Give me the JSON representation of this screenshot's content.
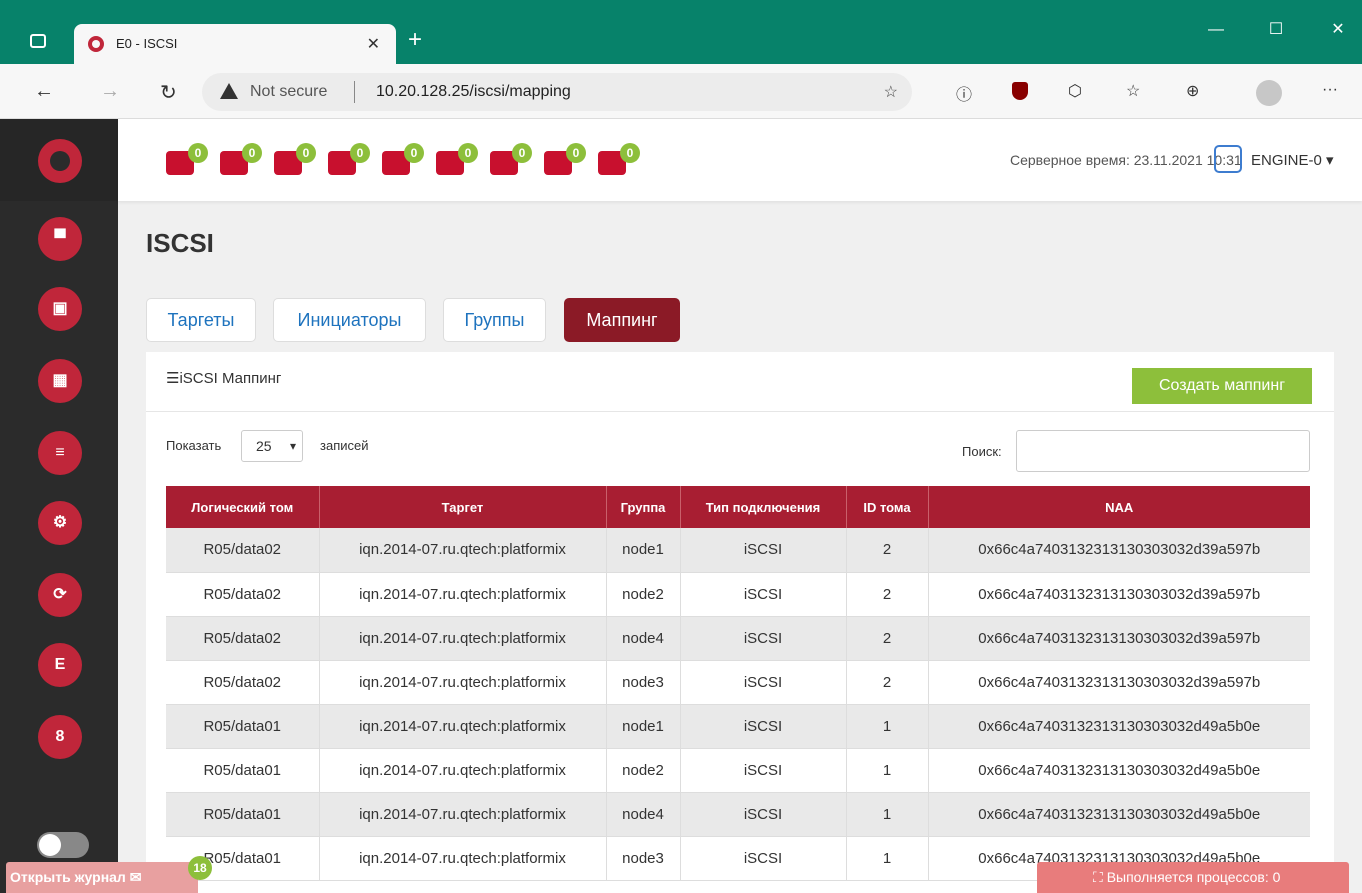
{
  "browser": {
    "tab_title": "E0 - ISCSI",
    "security_label": "Not secure",
    "url": "10.20.128.25/iscsi/mapping"
  },
  "header": {
    "badges": [
      "0",
      "0",
      "0",
      "0",
      "0",
      "0",
      "0",
      "0",
      "0"
    ],
    "server_time": "Серверное время: 23.11.2021 10:31",
    "user": "ENGINE-0"
  },
  "page": {
    "title": "ISCSI",
    "tabs": [
      "Таргеты",
      "Инициаторы",
      "Группы",
      "Маппинг"
    ],
    "card_title": "iSCSI Маппинг",
    "create_button": "Создать маппинг",
    "show_label": "Показать",
    "page_length": "25",
    "entries_label": "записей",
    "search_label": "Поиск:"
  },
  "table": {
    "columns": [
      "Логический том",
      "Таргет",
      "Группа",
      "Тип подключения",
      "ID тома",
      "NAA"
    ],
    "rows": [
      [
        "R05/data02",
        "iqn.2014-07.ru.qtech:platformix",
        "node1",
        "iSCSI",
        "2",
        "0x66c4a7403132313130303032d39a597b"
      ],
      [
        "R05/data02",
        "iqn.2014-07.ru.qtech:platformix",
        "node2",
        "iSCSI",
        "2",
        "0x66c4a7403132313130303032d39a597b"
      ],
      [
        "R05/data02",
        "iqn.2014-07.ru.qtech:platformix",
        "node4",
        "iSCSI",
        "2",
        "0x66c4a7403132313130303032d39a597b"
      ],
      [
        "R05/data02",
        "iqn.2014-07.ru.qtech:platformix",
        "node3",
        "iSCSI",
        "2",
        "0x66c4a7403132313130303032d39a597b"
      ],
      [
        "R05/data01",
        "iqn.2014-07.ru.qtech:platformix",
        "node1",
        "iSCSI",
        "1",
        "0x66c4a7403132313130303032d49a5b0e"
      ],
      [
        "R05/data01",
        "iqn.2014-07.ru.qtech:platformix",
        "node2",
        "iSCSI",
        "1",
        "0x66c4a7403132313130303032d49a5b0e"
      ],
      [
        "R05/data01",
        "iqn.2014-07.ru.qtech:platformix",
        "node4",
        "iSCSI",
        "1",
        "0x66c4a7403132313130303032d49a5b0e"
      ],
      [
        "R05/data01",
        "iqn.2014-07.ru.qtech:platformix",
        "node3",
        "iSCSI",
        "1",
        "0x66c4a7403132313130303032d49a5b0e"
      ]
    ]
  },
  "footer": {
    "journal_label": "Открыть журнал",
    "journal_count": "18",
    "processes_label": "Выполняется процессов: 0"
  },
  "colors": {
    "accent": "#a81e32",
    "active_tab": "#8b1a26",
    "create_button": "#8dbf3b",
    "titlebar": "#07826a"
  }
}
